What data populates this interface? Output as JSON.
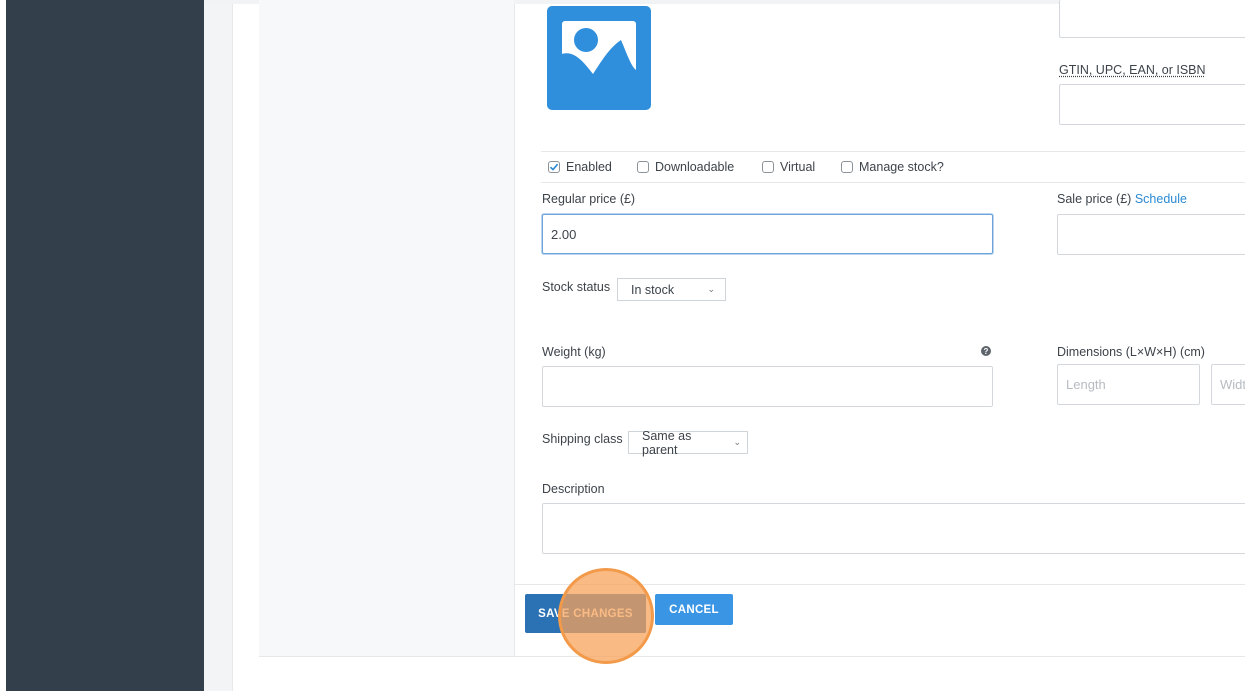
{
  "product": {
    "gtin_label": "GTIN, UPC, EAN, or ISBN",
    "checkboxes": [
      {
        "label": "Enabled",
        "checked": true
      },
      {
        "label": "Downloadable",
        "checked": false
      },
      {
        "label": "Virtual",
        "checked": false
      },
      {
        "label": "Manage stock?",
        "checked": false
      }
    ],
    "regular_price_label": "Regular price (£)",
    "regular_price_value": "2.00",
    "sale_price_label": "Sale price (£)",
    "schedule_link": "Schedule",
    "stock_status_label": "Stock status",
    "stock_status_value": "In stock",
    "weight_label": "Weight (kg)",
    "dimensions_label": "Dimensions (L×W×H) (cm)",
    "length_placeholder": "Length",
    "width_placeholder": "Width",
    "shipping_class_label": "Shipping class",
    "shipping_class_value": "Same as parent",
    "description_label": "Description"
  },
  "actions": {
    "save_label": "SAVE CHANGES",
    "cancel_label": "CANCEL"
  },
  "colors": {
    "sidebar": "#333f4a",
    "primary_button": "#2b72b5",
    "secondary_button": "#3a95e4",
    "link": "#2a8ad4",
    "click_indicator": "#f39a4a"
  },
  "icons": {
    "image_placeholder": "image-placeholder-icon",
    "help": "help-icon",
    "caret": "chevron-down-icon"
  }
}
